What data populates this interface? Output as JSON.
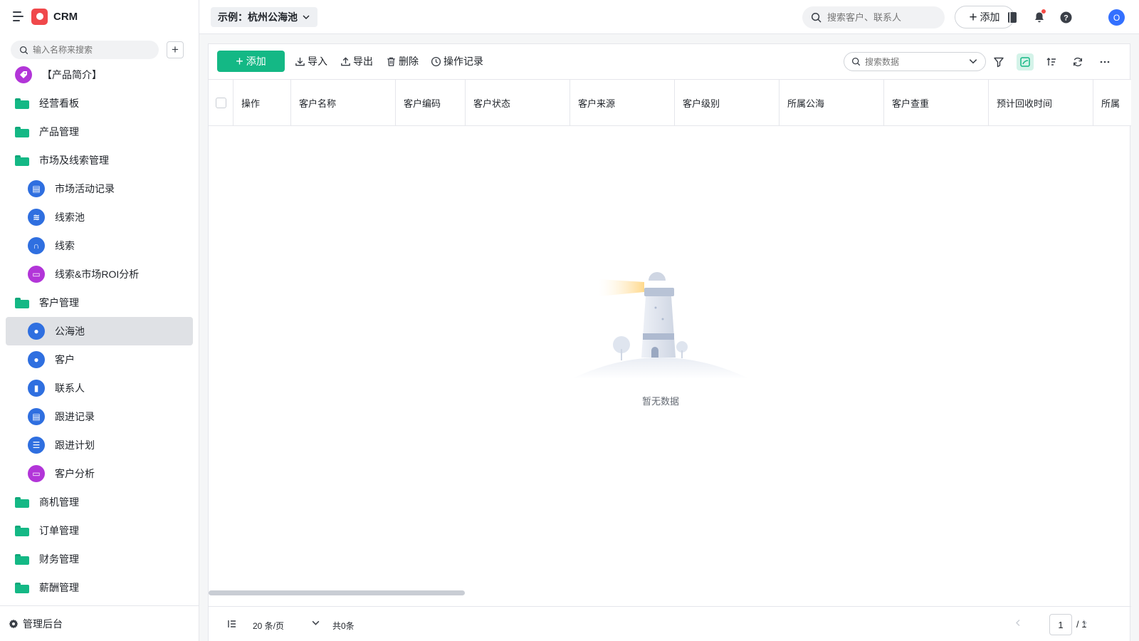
{
  "app": {
    "name": "CRM"
  },
  "sidebar": {
    "search_placeholder": "输入名称来搜索",
    "items": [
      {
        "label": "【产品简介】",
        "level": 1,
        "icon": "tag-icon"
      },
      {
        "label": "经营看板",
        "level": 1,
        "icon": "folder-icon"
      },
      {
        "label": "产品管理",
        "level": 1,
        "icon": "folder-icon"
      },
      {
        "label": "市场及线索管理",
        "level": 1,
        "icon": "folder-open-icon"
      },
      {
        "label": "市场活动记录",
        "level": 2,
        "icon": "document-icon"
      },
      {
        "label": "线索池",
        "level": 2,
        "icon": "pool-icon"
      },
      {
        "label": "线索",
        "level": 2,
        "icon": "lead-icon"
      },
      {
        "label": "线索&市场ROI分析",
        "level": 2,
        "icon": "analytics-icon"
      },
      {
        "label": "客户管理",
        "level": 1,
        "icon": "folder-open-icon"
      },
      {
        "label": "公海池",
        "level": 2,
        "icon": "customer-icon",
        "active": true
      },
      {
        "label": "客户",
        "level": 2,
        "icon": "customer-icon"
      },
      {
        "label": "联系人",
        "level": 2,
        "icon": "contact-icon"
      },
      {
        "label": "跟进记录",
        "level": 2,
        "icon": "followup-record-icon"
      },
      {
        "label": "跟进计划",
        "level": 2,
        "icon": "plan-icon"
      },
      {
        "label": "客户分析",
        "level": 2,
        "icon": "analytics-icon"
      },
      {
        "label": "商机管理",
        "level": 1,
        "icon": "folder-icon"
      },
      {
        "label": "订单管理",
        "level": 1,
        "icon": "folder-icon"
      },
      {
        "label": "财务管理",
        "level": 1,
        "icon": "folder-icon"
      },
      {
        "label": "薪酬管理",
        "level": 1,
        "icon": "folder-icon"
      }
    ],
    "admin_label": "管理后台"
  },
  "header": {
    "view_title": "示例：杭州公海池",
    "search_placeholder": "搜索客户、联系人",
    "add_label": "添加",
    "avatar_initial": "O"
  },
  "toolbar": {
    "add_label": "添加",
    "import_label": "导入",
    "export_label": "导出",
    "delete_label": "删除",
    "log_label": "操作记录",
    "search_placeholder": "搜索数据"
  },
  "table": {
    "columns": [
      "操作",
      "客户名称",
      "客户编码",
      "客户状态",
      "客户来源",
      "客户级别",
      "所属公海",
      "客户查重",
      "预计回收时间",
      "所属"
    ],
    "rows": [],
    "empty_text": "暂无数据"
  },
  "footer": {
    "page_size": "20 条/页",
    "total": "共0条",
    "current_page": "1",
    "total_pages": "/ 1"
  },
  "colors": {
    "primary_green": "#14b885",
    "folder_green": "#14b885",
    "icon_blue": "#2f6fe0",
    "icon_purple": "#b235d8",
    "avatar_blue": "#3370ff",
    "logo_red": "#f0484b"
  }
}
